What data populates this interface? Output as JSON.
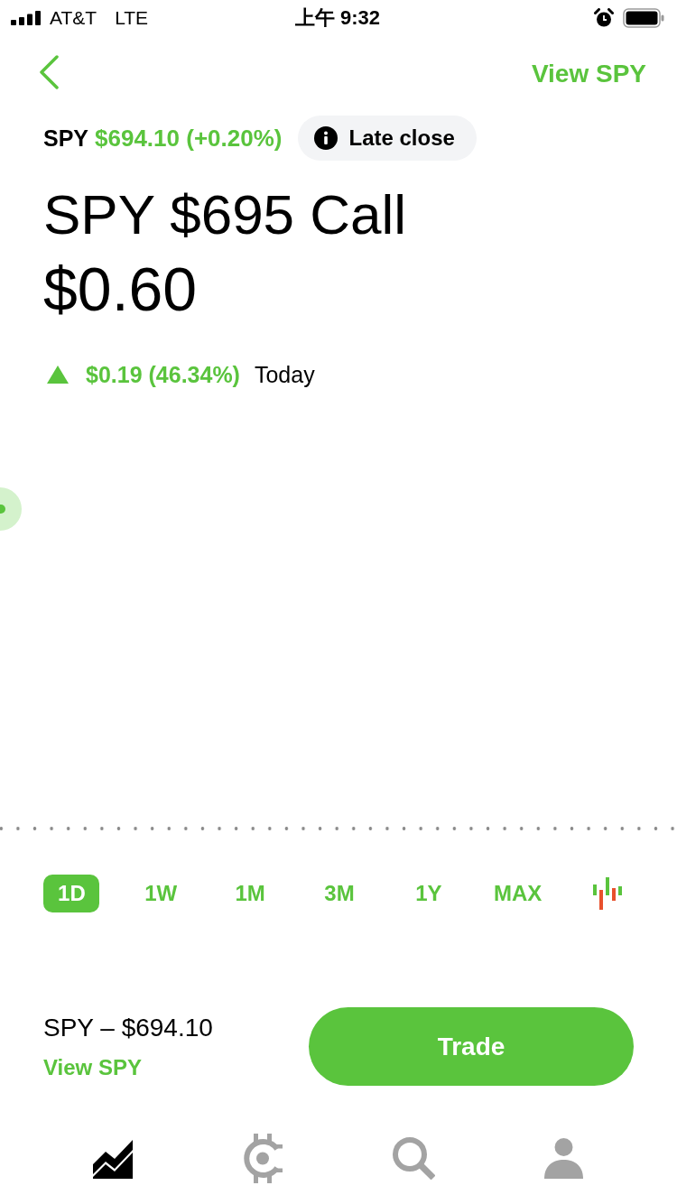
{
  "status_bar": {
    "carrier": "AT&T",
    "network": "LTE",
    "time": "上午 9:32"
  },
  "nav": {
    "action": "View SPY"
  },
  "quote": {
    "symbol": "SPY",
    "price_change": "$694.10 (+0.20%)",
    "badge": "Late close"
  },
  "title": "SPY $695 Call",
  "price": "$0.60",
  "change": {
    "up": true,
    "amount": "$0.19 (46.34%)",
    "period": "Today"
  },
  "ranges": [
    {
      "label": "1D",
      "selected": true
    },
    {
      "label": "1W",
      "selected": false
    },
    {
      "label": "1M",
      "selected": false
    },
    {
      "label": "3M",
      "selected": false
    },
    {
      "label": "1Y",
      "selected": false
    },
    {
      "label": "MAX",
      "selected": false
    }
  ],
  "footer": {
    "underlying": "SPY – $694.10",
    "link": "View SPY",
    "button": "Trade"
  },
  "tab_bar": [
    {
      "kind": "chart",
      "selected": true
    },
    {
      "kind": "crypto",
      "selected": false
    },
    {
      "kind": "search",
      "selected": false
    },
    {
      "kind": "account",
      "selected": false
    }
  ]
}
